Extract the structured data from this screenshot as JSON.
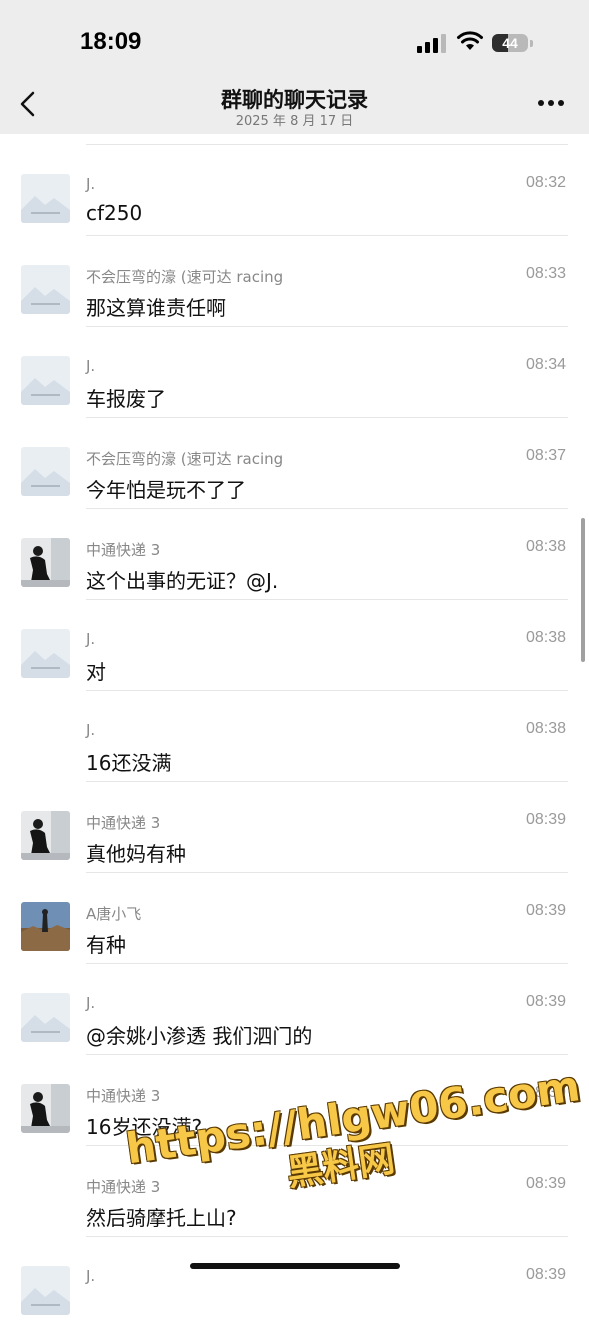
{
  "status_bar": {
    "time": "18:09",
    "battery": "44",
    "battery_level_percent": 44
  },
  "nav": {
    "title": "群聊的聊天记录",
    "subtitle": "2025 年 8 月 17 日"
  },
  "messages": [
    {
      "sender": "J.",
      "time": "08:32",
      "text": "cf250",
      "avatar": "placeholder"
    },
    {
      "sender": "不会压弯的濠 (速可达 racing",
      "time": "08:33",
      "text": "那这算谁责任啊",
      "avatar": "placeholder"
    },
    {
      "sender": "J.",
      "time": "08:34",
      "text": "车报废了",
      "avatar": "placeholder"
    },
    {
      "sender": "不会压弯的濠 (速可达 racing",
      "time": "08:37",
      "text": "今年怕是玩不了了",
      "avatar": "placeholder"
    },
    {
      "sender": "中通快递 3",
      "time": "08:38",
      "text": "这个出事的无证？@J.",
      "avatar": "photo-person"
    },
    {
      "sender": "J.",
      "time": "08:38",
      "text": "对",
      "avatar": "placeholder"
    },
    {
      "sender": "J.",
      "time": "08:38",
      "text": "16还没满",
      "avatar": "none"
    },
    {
      "sender": "中通快递 3",
      "time": "08:39",
      "text": "真他妈有种",
      "avatar": "photo-person"
    },
    {
      "sender": "A唐小飞",
      "time": "08:39",
      "text": "有种",
      "avatar": "photo-landscape"
    },
    {
      "sender": "J.",
      "time": "08:39",
      "text": "@余姚小渗透 我们泗门的",
      "avatar": "placeholder"
    },
    {
      "sender": "中通快递 3",
      "time": "08:39",
      "text": "16岁还没满?",
      "avatar": "photo-person"
    },
    {
      "sender": "中通快递 3",
      "time": "08:39",
      "text": "然后骑摩托上山?",
      "avatar": "none"
    },
    {
      "sender": "J.",
      "time": "08:39",
      "text": "",
      "avatar": "placeholder"
    }
  ],
  "watermark": {
    "line1": "https://hlgw06.com",
    "line2": "黑料网"
  },
  "colors": {
    "nav_background": "#ededed",
    "watermark": "#f7c748"
  }
}
